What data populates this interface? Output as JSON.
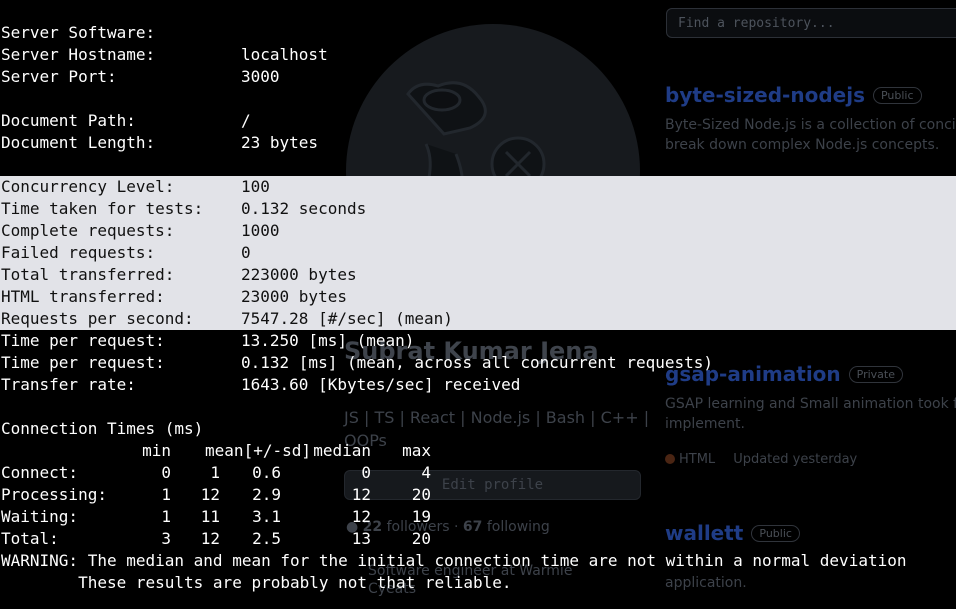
{
  "background": {
    "search": {
      "placeholder": "Find a repository..."
    },
    "profile": {
      "name": "Subrat Kumar Jena",
      "bio_line1": "JS | TS | React | Node.js | Bash | C++ |",
      "bio_line2": "OOPs",
      "edit_button": "Edit profile",
      "followers_count": "22",
      "followers_label": "followers",
      "following_count": "67",
      "following_label": "following",
      "work_line1": "Software engineer at Warmie",
      "work_line2": "Cyeats"
    },
    "repos": [
      {
        "name": "byte-sized-nodejs",
        "visibility": "Public",
        "desc_line1": "Byte-Sized Node.js is a collection of concise",
        "desc_line2": "break down complex Node.js concepts."
      },
      {
        "name": "gsap-animation",
        "visibility": "Private",
        "desc_line1": "GSAP learning and Small animation took fro",
        "desc_line2": "implement.",
        "language": "HTML",
        "updated": "Updated yesterday"
      },
      {
        "name": "wallett",
        "visibility": "Public",
        "desc_line1": "application."
      }
    ],
    "colors": {
      "repo_link": "#1f3c86",
      "html_lang": "#4a2513"
    }
  },
  "terminal": {
    "colors": {
      "text": "#ffffff",
      "selection_bg": "#e2e3e8",
      "selection_text": "#111111"
    },
    "lines": [
      {
        "label": "Server Software:",
        "value": ""
      },
      {
        "label": "Server Hostname:",
        "value": "localhost"
      },
      {
        "label": "Server Port:",
        "value": "3000"
      },
      {
        "label": "",
        "value": ""
      },
      {
        "label": "Document Path:",
        "value": "/"
      },
      {
        "label": "Document Length:",
        "value": "23 bytes"
      },
      {
        "label": "",
        "value": ""
      },
      {
        "label": "Concurrency Level:",
        "value": "100"
      },
      {
        "label": "Time taken for tests:",
        "value": "0.132 seconds"
      },
      {
        "label": "Complete requests:",
        "value": "1000"
      },
      {
        "label": "Failed requests:",
        "value": "0"
      },
      {
        "label": "Total transferred:",
        "value": "223000 bytes"
      },
      {
        "label": "HTML transferred:",
        "value": "23000 bytes"
      },
      {
        "label": "Requests per second:",
        "value": "7547.28 [#/sec] (mean)"
      },
      {
        "label": "Time per request:",
        "value": "13.250 [ms] (mean)"
      },
      {
        "label": "Time per request:",
        "value": "0.132 [ms] (mean, across all concurrent requests)"
      },
      {
        "label": "Transfer rate:",
        "value": "1643.60 [Kbytes/sec] received"
      },
      {
        "label": "",
        "value": ""
      },
      {
        "label": "Connection Times (ms)",
        "value": ""
      }
    ],
    "connection_table": {
      "headers": [
        "min",
        "mean[+/-sd]",
        "median",
        "max"
      ],
      "rows": [
        {
          "label": "Connect:",
          "min": "0",
          "mean": "1",
          "sd": "0.6",
          "median": "0",
          "max": "4"
        },
        {
          "label": "Processing:",
          "min": "1",
          "mean": "12",
          "sd": "2.9",
          "median": "12",
          "max": "20"
        },
        {
          "label": "Waiting:",
          "min": "1",
          "mean": "11",
          "sd": "3.1",
          "median": "12",
          "max": "19"
        },
        {
          "label": "Total:",
          "min": "3",
          "mean": "12",
          "sd": "2.5",
          "median": "13",
          "max": "20"
        }
      ]
    },
    "warning_line1": "WARNING: The median and mean for the initial connection time are not within a normal deviation",
    "warning_line2": "        These results are probably not that reliable."
  }
}
